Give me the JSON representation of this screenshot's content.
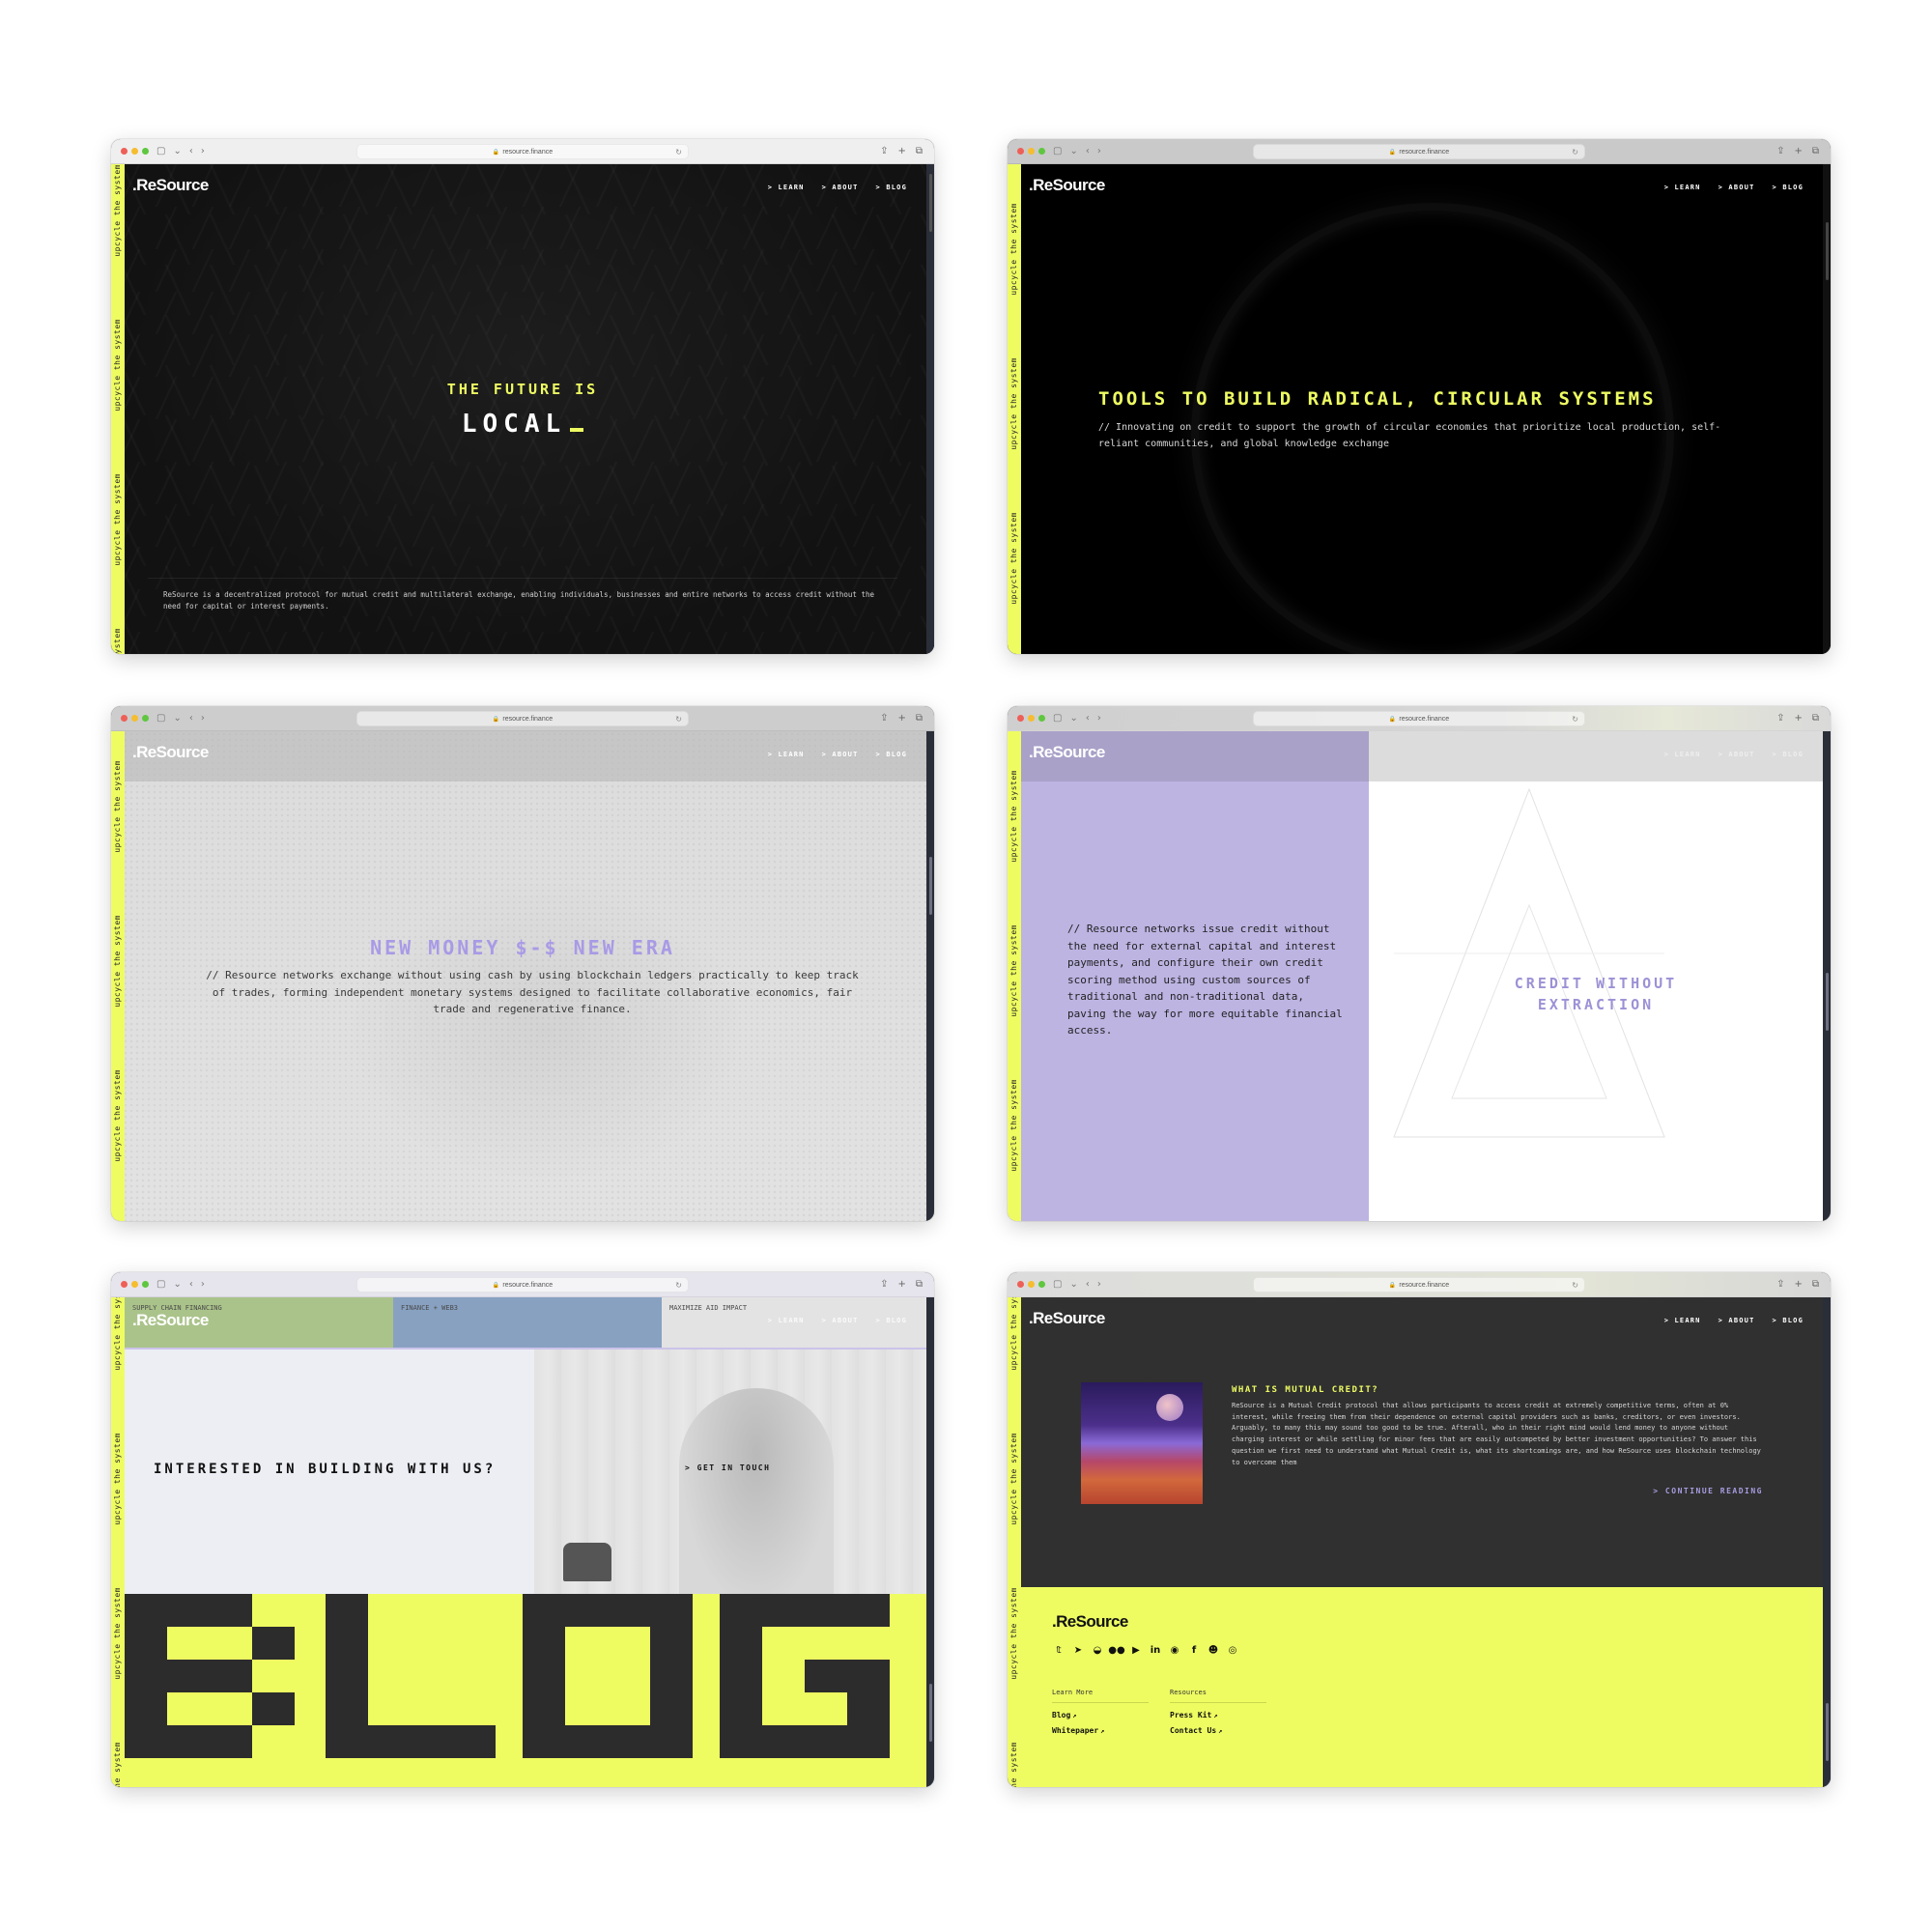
{
  "browser": {
    "url": "resource.finance",
    "lock_icon": "🔒",
    "reload_icon": "↻",
    "sidebar_icon": "▢",
    "chevron_down_icon": "⌄",
    "back_icon": "‹",
    "forward_icon": "›",
    "share_icon": "⇪",
    "new_tab_icon": "+",
    "tabs_icon": "⧉"
  },
  "brand": {
    "logo": ".ReSource",
    "accent_yellow": "#eefc62",
    "accent_purple": "#a99ae6"
  },
  "marquee": {
    "text": "upcycle the system"
  },
  "nav": {
    "items": [
      {
        "label": "> LEARN"
      },
      {
        "label": "> ABOUT"
      },
      {
        "label": "> BLOG"
      }
    ]
  },
  "screens": {
    "home": {
      "hero_line1": "THE FUTURE IS",
      "hero_line2": "LOCAL",
      "blurb": "ReSource is a decentralized protocol for mutual credit and multilateral exchange, enabling individuals, businesses and entire networks to access credit without the need for capital or interest payments."
    },
    "tools": {
      "title": "TOOLS TO BUILD RADICAL, CIRCULAR SYSTEMS",
      "subtitle": "// Innovating on credit to support the growth of circular economies that prioritize local production, self-reliant communities, and global knowledge exchange"
    },
    "money": {
      "title": "NEW MONEY $-$ NEW ERA",
      "subtitle": "// Resource networks exchange without using cash by using blockchain ledgers practically to keep track of trades, forming independent monetary systems designed to facilitate collaborative economics, fair trade and regenerative finance."
    },
    "credit": {
      "body": "// Resource networks issue credit without the need for external capital and interest payments, and configure their own credit scoring method using custom sources of traditional and non-traditional data, paving the way for more equitable financial access.",
      "title_line1": "CREDIT WITHOUT",
      "title_line2": "EXTRACTION"
    },
    "contact": {
      "tabs": [
        {
          "label": "SUPPLY CHAIN FINANCING"
        },
        {
          "label": "FINANCE + WEB3"
        },
        {
          "label": "MAXIMIZE AID IMPACT"
        }
      ],
      "question": "INTERESTED IN BUILDING WITH US?",
      "cta": "> GET IN TOUCH",
      "big_word": "BLOG"
    },
    "blog": {
      "post_title": "WHAT IS MUTUAL CREDIT?",
      "post_body": "ReSource is a Mutual Credit protocol that allows participants to access credit at extremely competitive terms, often at 0% interest, while freeing them from their dependence on external capital providers such as banks, creditors, or even investors. Arguably, to many this may sound too good to be true. Afterall, who in their right mind would lend money to anyone without charging interest or while settling for minor fees that are easily outcompeted by better investment opportunities? To answer this question we first need to understand what Mutual Credit is, what its shortcomings are, and how ReSource uses blockchain technology to overcome them",
      "continue": "> CONTINUE READING",
      "footer": {
        "logo": ".ReSource",
        "socials": [
          {
            "name": "twitter",
            "glyph": "𝕥"
          },
          {
            "name": "telegram",
            "glyph": "➤"
          },
          {
            "name": "discord",
            "glyph": "◒"
          },
          {
            "name": "medium",
            "glyph": "●●"
          },
          {
            "name": "youtube",
            "glyph": "▶"
          },
          {
            "name": "linkedin",
            "glyph": "in"
          },
          {
            "name": "github",
            "glyph": "◉"
          },
          {
            "name": "facebook",
            "glyph": "f"
          },
          {
            "name": "reddit",
            "glyph": "☻"
          },
          {
            "name": "instagram",
            "glyph": "◎"
          }
        ],
        "columns": [
          {
            "heading": "Learn More",
            "links": [
              {
                "label": "Blog"
              },
              {
                "label": "Whitepaper"
              }
            ]
          },
          {
            "heading": "Resources",
            "links": [
              {
                "label": "Press Kit"
              },
              {
                "label": "Contact Us"
              }
            ]
          }
        ],
        "external_icon": "↗"
      }
    }
  }
}
